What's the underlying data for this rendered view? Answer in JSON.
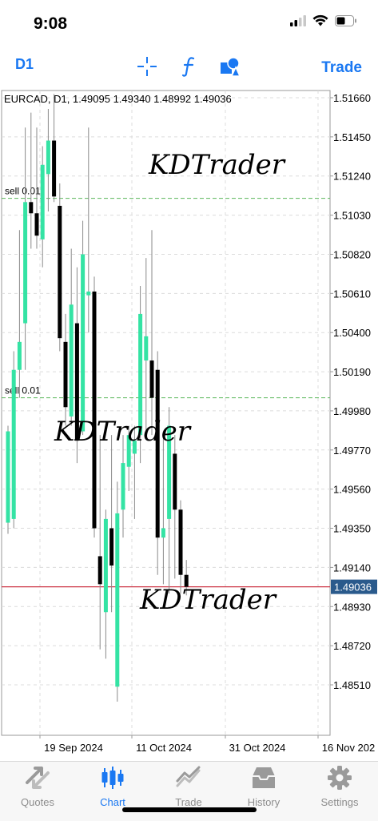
{
  "status": {
    "time": "9:08"
  },
  "toolbar": {
    "timeframe": "D1",
    "crosshair_icon": "crosshair-icon",
    "indicators_icon": "function-icon",
    "objects_icon": "shapes-icon",
    "trade_label": "Trade",
    "accent_color": "#1a78f2"
  },
  "chart": {
    "header": "EURCAD, D1, 1.49095 1.49340 1.48992 1.49036",
    "current_price": "1.49036",
    "price_labels": [
      "1.51660",
      "1.51450",
      "1.51240",
      "1.51030",
      "1.50820",
      "1.50610",
      "1.50400",
      "1.50190",
      "1.49980",
      "1.49770",
      "1.49560",
      "1.49350",
      "1.49140",
      "1.48930",
      "1.48720",
      "1.48510"
    ],
    "date_labels": [
      "19 Sep 2024",
      "11 Oct 2024",
      "31 Oct 2024",
      "16 Nov 202"
    ],
    "orders": [
      {
        "label": "sell 0.01",
        "price": 1.5112
      },
      {
        "label": "sell 0.01",
        "price": 1.5005
      }
    ],
    "watermarks": [
      "KDTrader",
      "KDTrader",
      "KDTrader"
    ],
    "colors": {
      "bull": "#34e3a4",
      "bear": "#000000",
      "order_line": "#5cb85c",
      "bid_line": "#cc3344",
      "price_tag": "#2a5a8c"
    }
  },
  "chart_data": {
    "type": "candlestick",
    "symbol": "EURCAD",
    "timeframe": "D1",
    "ylim": [
      1.4836,
      1.5175
    ],
    "candles": [
      {
        "o": 1.4938,
        "h": 1.499,
        "l": 1.4932,
        "c": 1.4987
      },
      {
        "o": 1.494,
        "h": 1.503,
        "l": 1.4935,
        "c": 1.502
      },
      {
        "o": 1.502,
        "h": 1.5095,
        "l": 1.5005,
        "c": 1.5035
      },
      {
        "o": 1.5045,
        "h": 1.515,
        "l": 1.502,
        "c": 1.511
      },
      {
        "o": 1.511,
        "h": 1.5158,
        "l": 1.5085,
        "c": 1.5104
      },
      {
        "o": 1.5104,
        "h": 1.515,
        "l": 1.5085,
        "c": 1.5092
      },
      {
        "o": 1.509,
        "h": 1.514,
        "l": 1.5075,
        "c": 1.513
      },
      {
        "o": 1.5125,
        "h": 1.516,
        "l": 1.5105,
        "c": 1.5143
      },
      {
        "o": 1.5143,
        "h": 1.5168,
        "l": 1.511,
        "c": 1.5113
      },
      {
        "o": 1.5108,
        "h": 1.512,
        "l": 1.503,
        "c": 1.5037
      },
      {
        "o": 1.5035,
        "h": 1.505,
        "l": 1.499,
        "c": 1.5
      },
      {
        "o": 1.4995,
        "h": 1.5085,
        "l": 1.499,
        "c": 1.5055
      },
      {
        "o": 1.5045,
        "h": 1.5075,
        "l": 1.497,
        "c": 1.4982
      },
      {
        "o": 1.4987,
        "h": 1.51,
        "l": 1.4985,
        "c": 1.5082
      },
      {
        "o": 1.506,
        "h": 1.515,
        "l": 1.504,
        "c": 1.5062
      },
      {
        "o": 1.5062,
        "h": 1.507,
        "l": 1.493,
        "c": 1.4935
      },
      {
        "o": 1.492,
        "h": 1.4985,
        "l": 1.487,
        "c": 1.4905
      },
      {
        "o": 1.489,
        "h": 1.4945,
        "l": 1.4865,
        "c": 1.494
      },
      {
        "o": 1.4935,
        "h": 1.4985,
        "l": 1.489,
        "c": 1.4915
      },
      {
        "o": 1.485,
        "h": 1.496,
        "l": 1.4842,
        "c": 1.4943
      },
      {
        "o": 1.4945,
        "h": 1.4985,
        "l": 1.493,
        "c": 1.497
      },
      {
        "o": 1.4968,
        "h": 1.499,
        "l": 1.4955,
        "c": 1.4985
      },
      {
        "o": 1.4975,
        "h": 1.499,
        "l": 1.494,
        "c": 1.4982
      },
      {
        "o": 1.4985,
        "h": 1.5065,
        "l": 1.497,
        "c": 1.505
      },
      {
        "o": 1.5025,
        "h": 1.508,
        "l": 1.4985,
        "c": 1.5038
      },
      {
        "o": 1.5025,
        "h": 1.5095,
        "l": 1.4985,
        "c": 1.5005
      },
      {
        "o": 1.502,
        "h": 1.503,
        "l": 1.491,
        "c": 1.493
      },
      {
        "o": 1.493,
        "h": 1.4985,
        "l": 1.4905,
        "c": 1.4935
      },
      {
        "o": 1.494,
        "h": 1.5,
        "l": 1.49,
        "c": 1.499
      },
      {
        "o": 1.4975,
        "h": 1.4985,
        "l": 1.4908,
        "c": 1.4945
      },
      {
        "o": 1.4945,
        "h": 1.495,
        "l": 1.49,
        "c": 1.491
      },
      {
        "o": 1.491,
        "h": 1.4918,
        "l": 1.4899,
        "c": 1.49036
      }
    ]
  },
  "tabs": [
    {
      "label": "Quotes",
      "icon": "quotes-icon",
      "active": false
    },
    {
      "label": "Chart",
      "icon": "chart-icon",
      "active": true
    },
    {
      "label": "Trade",
      "icon": "trade-icon",
      "active": false
    },
    {
      "label": "History",
      "icon": "history-icon",
      "active": false
    },
    {
      "label": "Settings",
      "icon": "gear-icon",
      "active": false
    }
  ]
}
